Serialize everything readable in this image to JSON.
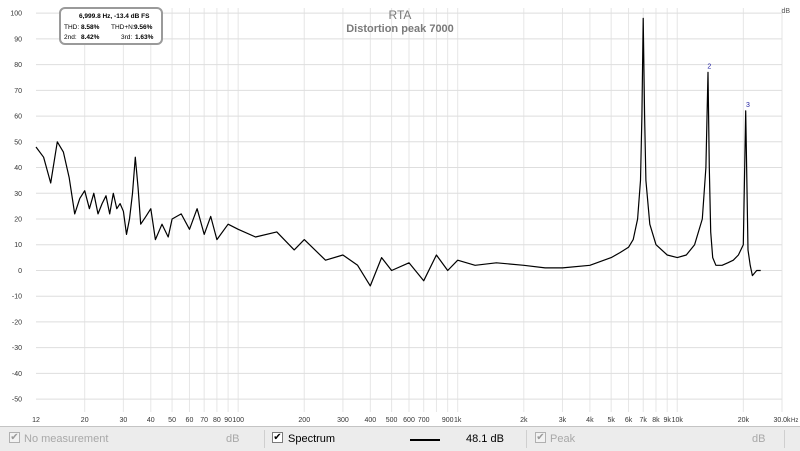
{
  "chart_data": {
    "type": "line",
    "title": "RTA",
    "subtitle": "Distortion peak 7000",
    "ylabel": "dB",
    "xlabel": "Hz",
    "xscale": "log",
    "xlim": [
      12,
      30000
    ],
    "ylim": [
      -55,
      102
    ],
    "yticks": [
      100,
      90,
      80,
      70,
      60,
      50,
      40,
      30,
      20,
      10,
      0,
      -10,
      -20,
      -30,
      -40,
      -50
    ],
    "xticks": [
      {
        "v": 12,
        "label": "12"
      },
      {
        "v": 20,
        "label": "20"
      },
      {
        "v": 30,
        "label": "30"
      },
      {
        "v": 40,
        "label": "40"
      },
      {
        "v": 50,
        "label": "50"
      },
      {
        "v": 60,
        "label": "60"
      },
      {
        "v": 70,
        "label": "70"
      },
      {
        "v": 80,
        "label": "80"
      },
      {
        "v": 90,
        "label": "90"
      },
      {
        "v": 100,
        "label": "100"
      },
      {
        "v": 200,
        "label": "200"
      },
      {
        "v": 300,
        "label": "300"
      },
      {
        "v": 400,
        "label": "400"
      },
      {
        "v": 500,
        "label": "500"
      },
      {
        "v": 600,
        "label": "600"
      },
      {
        "v": 700,
        "label": "700"
      },
      {
        "v": 900,
        "label": "900"
      },
      {
        "v": 1000,
        "label": "1k"
      },
      {
        "v": 2000,
        "label": "2k"
      },
      {
        "v": 3000,
        "label": "3k"
      },
      {
        "v": 4000,
        "label": "4k"
      },
      {
        "v": 5000,
        "label": "5k"
      },
      {
        "v": 6000,
        "label": "6k"
      },
      {
        "v": 7000,
        "label": "7k"
      },
      {
        "v": 8000,
        "label": "8k"
      },
      {
        "v": 9000,
        "label": "9k"
      },
      {
        "v": 10000,
        "label": "10k"
      },
      {
        "v": 20000,
        "label": "20k"
      },
      {
        "v": 30000,
        "label": "30.0k"
      }
    ],
    "grid": true,
    "series": [
      {
        "name": "Spectrum",
        "color": "#000000",
        "x": [
          12,
          13,
          14,
          15,
          16,
          17,
          18,
          19,
          20,
          21,
          22,
          23,
          24,
          25,
          26,
          27,
          28,
          29,
          30,
          31,
          32,
          33,
          34,
          35,
          36,
          38,
          40,
          42,
          45,
          48,
          50,
          55,
          60,
          65,
          70,
          75,
          80,
          90,
          100,
          120,
          150,
          180,
          200,
          250,
          300,
          350,
          400,
          450,
          500,
          600,
          700,
          800,
          900,
          1000,
          1200,
          1500,
          2000,
          2500,
          3000,
          4000,
          5000,
          5500,
          6000,
          6300,
          6600,
          6800,
          6900,
          7000,
          7100,
          7200,
          7500,
          8000,
          9000,
          10000,
          11000,
          12000,
          13000,
          13500,
          13800,
          14000,
          14200,
          14500,
          15000,
          16000,
          17000,
          18000,
          19000,
          20000,
          20500,
          21000,
          21500,
          22000,
          23000,
          24000
        ],
        "y": [
          48,
          44,
          34,
          50,
          46,
          36,
          22,
          28,
          31,
          24,
          30,
          22,
          26,
          29,
          22,
          30,
          24,
          26,
          23,
          14,
          20,
          30,
          44,
          32,
          18,
          21,
          24,
          12,
          18,
          13,
          20,
          22,
          16,
          24,
          14,
          21,
          12,
          18,
          16,
          13,
          15,
          8,
          12,
          4,
          6,
          2,
          -6,
          5,
          0,
          3,
          -4,
          6,
          0,
          4,
          2,
          3,
          2,
          1,
          1,
          2,
          5,
          7,
          9,
          12,
          20,
          35,
          60,
          98,
          60,
          35,
          18,
          10,
          6,
          5,
          6,
          10,
          20,
          40,
          77,
          40,
          15,
          5,
          2,
          2,
          3,
          4,
          6,
          10,
          62,
          8,
          2,
          -2,
          0,
          0
        ]
      }
    ],
    "annotations": [
      {
        "label": "2",
        "x": 14000,
        "y": 77
      },
      {
        "label": "3",
        "x": 21000,
        "y": 62
      }
    ],
    "info": {
      "freq": "6,999.8 Hz, -13.4 dB FS",
      "thd_label": "THD:",
      "thd": "8.58%",
      "thdn_label": "THD+N:",
      "thdn": "9.56%",
      "h2_label": "2nd:",
      "h2": "8.42%",
      "h3_label": "3rd:",
      "h3": "1.63%"
    }
  },
  "footer": {
    "no_measurement": "No measurement",
    "db_left": "dB",
    "spectrum": "Spectrum",
    "spectrum_value": "48.1 dB",
    "peak": "Peak",
    "db_right": "dB",
    "check_mark": "✔"
  }
}
